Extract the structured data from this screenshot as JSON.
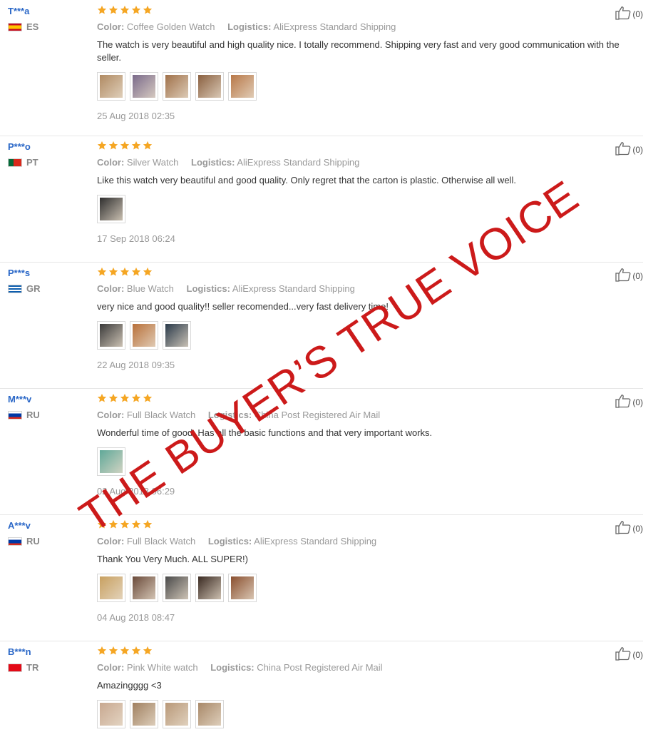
{
  "labels": {
    "color": "Color:",
    "logistics": "Logistics:"
  },
  "watermark": "THE BUYER’S TRUE VOICE",
  "reviews": [
    {
      "user": "T***a",
      "country": "ES",
      "flag_colors": [
        "#c60b1e",
        "#ffc400",
        "#c60b1e"
      ],
      "stars": 5,
      "color": "Coffee Golden Watch",
      "logistics": "AliExpress Standard Shipping",
      "text": "The watch is very beautiful and high quality nice. I totally recommend. Shipping very fast and very good communication with the seller.",
      "photos": [
        "#b08a62",
        "#7a6a8a",
        "#a0714a",
        "#8a6040",
        "#b87848"
      ],
      "date": "25 Aug 2018 02:35",
      "helpful": "(0)"
    },
    {
      "user": "P***o",
      "country": "PT",
      "flag_colors": [
        "#046a38",
        "#da291c",
        "#da291c"
      ],
      "stars": 5,
      "color": "Silver Watch",
      "logistics": "AliExpress Standard Shipping",
      "text": "Like this watch very beautiful and good quality. Only regret that the carton is plastic. Otherwise all well.",
      "photos": [
        "#2e2e2e"
      ],
      "date": "17 Sep 2018 06:24",
      "helpful": "(0)"
    },
    {
      "user": "P***s",
      "country": "GR",
      "flag_colors": [
        "#0d5eaf",
        "#ffffff",
        "#0d5eaf"
      ],
      "stars": 5,
      "color": "Blue Watch",
      "logistics": "AliExpress Standard Shipping",
      "text": "very nice and good quality!! seller recomended...very fast delivery time!",
      "photos": [
        "#3a3a3a",
        "#b8703a",
        "#2a3a4a"
      ],
      "date": "22 Aug 2018 09:35",
      "helpful": "(0)"
    },
    {
      "user": "M***v",
      "country": "RU",
      "flag_colors": [
        "#ffffff",
        "#0039a6",
        "#d52b1e"
      ],
      "stars": 5,
      "color": "Full Black Watch",
      "logistics": "China Post Registered Air Mail",
      "text": "Wonderful time of good. Has all the basic functions and that very important works.",
      "photos": [
        "#5fa898"
      ],
      "date": "02 Aug 2018 06:29",
      "helpful": "(0)"
    },
    {
      "user": "A***v",
      "country": "RU",
      "flag_colors": [
        "#ffffff",
        "#0039a6",
        "#d52b1e"
      ],
      "stars": 5,
      "color": "Full Black Watch",
      "logistics": "AliExpress Standard Shipping",
      "text": "Thank You Very Much. ALL SUPER!)",
      "photos": [
        "#c8a060",
        "#6a4a3a",
        "#4a4a4a",
        "#3a2a22",
        "#8a5030"
      ],
      "date": "04 Aug 2018 08:47",
      "helpful": "(0)"
    },
    {
      "user": "B***n",
      "country": "TR",
      "flag_colors": [
        "#e30a17",
        "#e30a17",
        "#e30a17"
      ],
      "stars": 5,
      "color": "Pink White watch",
      "logistics": "China Post Registered Air Mail",
      "text": "Amazingggg <3",
      "photos": [
        "#c8a890",
        "#a08060",
        "#b89878",
        "#a88868"
      ],
      "date": "",
      "helpful": "(0)"
    }
  ]
}
